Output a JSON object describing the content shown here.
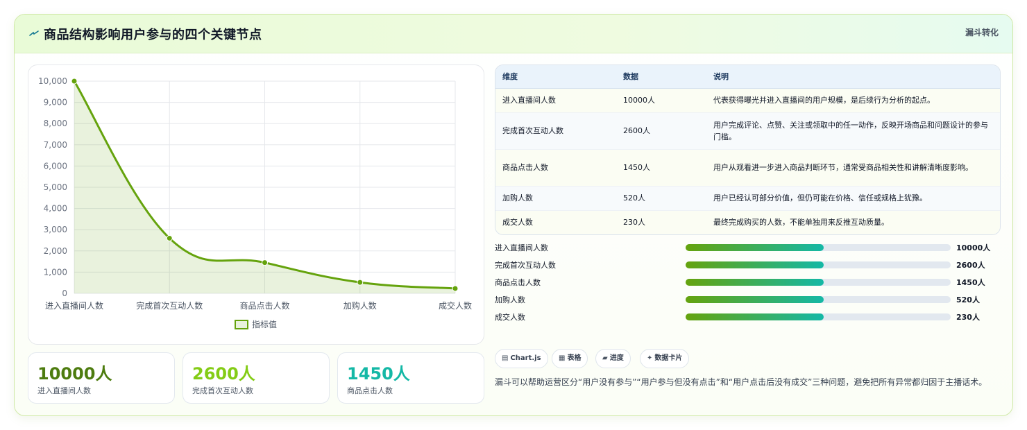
{
  "header": {
    "title": "商品结构影响用户参与的四个关键节点",
    "tag": "漏斗转化",
    "icon": "lightning-icon"
  },
  "chart_data": {
    "type": "line",
    "categories": [
      "进入直播间人数",
      "完成首次互动人数",
      "商品点击人数",
      "加购人数",
      "成交人数"
    ],
    "series": [
      {
        "name": "指标值",
        "values": [
          10000,
          2600,
          1450,
          520,
          230
        ]
      }
    ],
    "ylim": [
      0,
      10000
    ],
    "yticks": [
      "0",
      "1,000",
      "2,000",
      "3,000",
      "4,000",
      "5,000",
      "6,000",
      "7,000",
      "8,000",
      "9,000",
      "10,000"
    ],
    "grid": true,
    "legend": "bottom",
    "fill": true,
    "color": "#65a30d"
  },
  "stats": [
    {
      "value": "10000人",
      "label": "进入直播间人数",
      "color": "#4d7c0f"
    },
    {
      "value": "2600人",
      "label": "完成首次互动人数",
      "color": "#84cc16"
    },
    {
      "value": "1450人",
      "label": "商品点击人数",
      "color": "#14b8a6"
    }
  ],
  "table": {
    "headers": [
      "维度",
      "数据",
      "说明"
    ],
    "rows": [
      [
        "进入直播间人数",
        "10000人",
        "代表获得曝光并进入直播间的用户规模，是后续行为分析的起点。"
      ],
      [
        "完成首次互动人数",
        "2600人",
        "用户完成评论、点赞、关注或领取中的任一动作，反映开场商品和问题设计的参与门槛。"
      ],
      [
        "商品点击人数",
        "1450人",
        "用户从观看进一步进入商品判断环节，通常受商品相关性和讲解清晰度影响。"
      ],
      [
        "加购人数",
        "520人",
        "用户已经认可部分价值，但仍可能在价格、信任或规格上犹豫。"
      ],
      [
        "成交人数",
        "230人",
        "最终完成购买的人数，不能单独用来反推互动质量。"
      ]
    ]
  },
  "progress": [
    {
      "label": "进入直播间人数",
      "value": "10000人",
      "fill": 0.52
    },
    {
      "label": "完成首次互动人数",
      "value": "2600人",
      "fill": 0.52
    },
    {
      "label": "商品点击人数",
      "value": "1450人",
      "fill": 0.52
    },
    {
      "label": "加购人数",
      "value": "520人",
      "fill": 0.52
    },
    {
      "label": "成交人数",
      "value": "230人",
      "fill": 0.52
    }
  ],
  "chips": [
    {
      "icon": "chart-icon",
      "glyph": "▤",
      "label": "Chart.js"
    },
    {
      "icon": "table-icon",
      "glyph": "▦",
      "label": "表格"
    },
    {
      "icon": "progress-icon",
      "glyph": "▰",
      "label": "进度"
    },
    {
      "icon": "sparkle-icon",
      "glyph": "✦",
      "label": "数据卡片"
    }
  ],
  "note": "漏斗可以帮助运营区分“用户没有参与”“用户参与但没有点击”和“用户点击后没有成交”三种问题，避免把所有异常都归因于主播话术。"
}
